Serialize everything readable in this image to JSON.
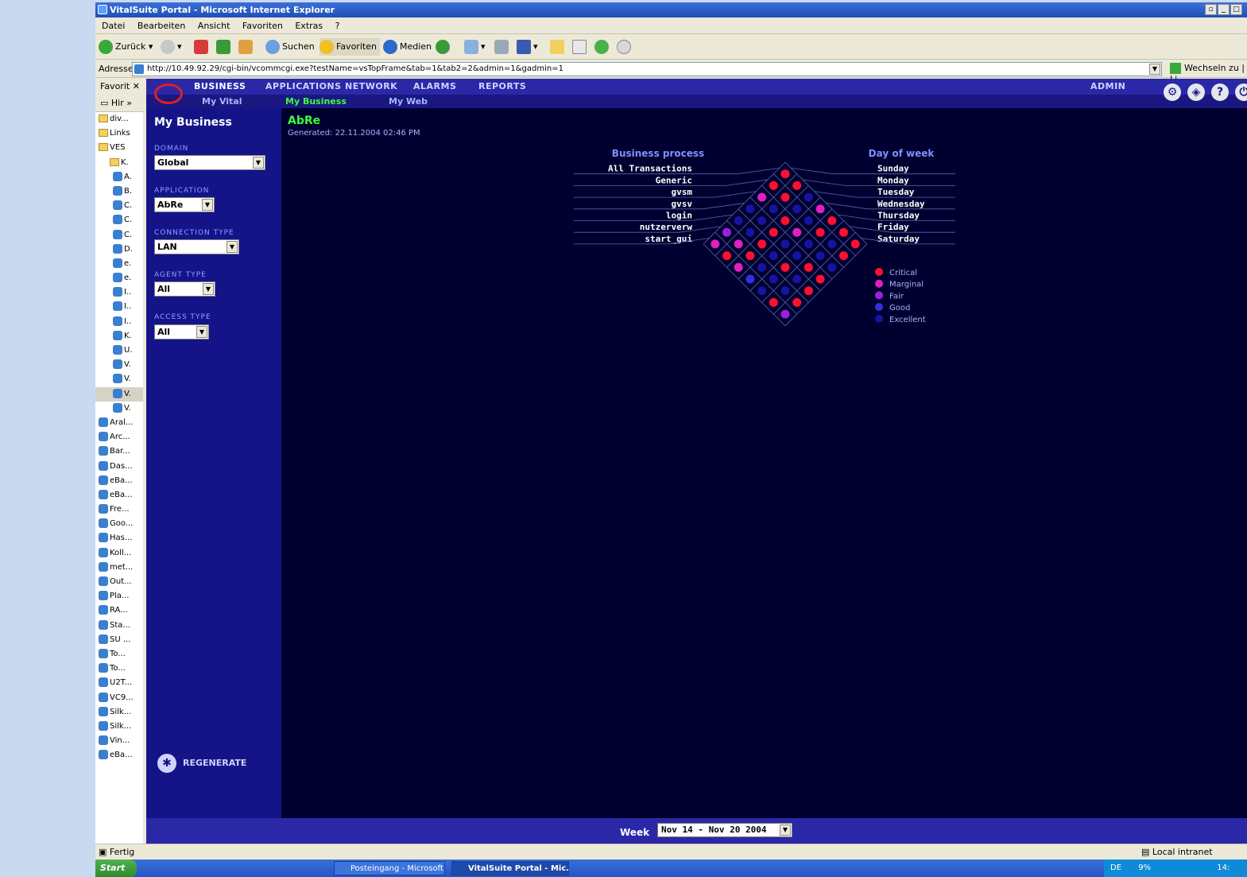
{
  "window": {
    "title": "VitalSuite Portal - Microsoft Internet Explorer"
  },
  "menubar": [
    "Datei",
    "Bearbeiten",
    "Ansicht",
    "Favoriten",
    "Extras",
    "?"
  ],
  "toolbar": {
    "back": "Zurück",
    "search": "Suchen",
    "favorites": "Favoriten",
    "media": "Medien"
  },
  "address": {
    "label": "Adresse",
    "url": "http://10.49.92.29/cgi-bin/vcommcgi.exe?testName=vsTopFrame&tab=1&tab2=2&admin=1&gadmin=1",
    "go": "Wechseln zu",
    "links": "Li"
  },
  "favorites": {
    "title": "Favorit",
    "history": "Hir",
    "items": [
      {
        "label": "div...",
        "type": "folder"
      },
      {
        "label": "Links",
        "type": "folder"
      },
      {
        "label": "VES",
        "type": "folder"
      },
      {
        "label": "K.",
        "type": "folder"
      },
      {
        "label": "A.",
        "type": "link"
      },
      {
        "label": "B.",
        "type": "link"
      },
      {
        "label": "C.",
        "type": "link"
      },
      {
        "label": "C.",
        "type": "link"
      },
      {
        "label": "C.",
        "type": "link"
      },
      {
        "label": "D.",
        "type": "link"
      },
      {
        "label": "e.",
        "type": "link"
      },
      {
        "label": "e.",
        "type": "link"
      },
      {
        "label": "I..",
        "type": "link"
      },
      {
        "label": "I..",
        "type": "link"
      },
      {
        "label": "I..",
        "type": "link"
      },
      {
        "label": "K.",
        "type": "link"
      },
      {
        "label": "U.",
        "type": "link"
      },
      {
        "label": "V.",
        "type": "link"
      },
      {
        "label": "V.",
        "type": "link"
      },
      {
        "label": "V.",
        "type": "link"
      },
      {
        "label": "V.",
        "type": "link"
      },
      {
        "label": "Aral...",
        "type": "link"
      },
      {
        "label": "Arc...",
        "type": "link"
      },
      {
        "label": "Bar...",
        "type": "link"
      },
      {
        "label": "Das...",
        "type": "link"
      },
      {
        "label": "eBa...",
        "type": "link"
      },
      {
        "label": "eBa...",
        "type": "link"
      },
      {
        "label": "Fre...",
        "type": "link"
      },
      {
        "label": "Goo...",
        "type": "link"
      },
      {
        "label": "Has...",
        "type": "link"
      },
      {
        "label": "Koll...",
        "type": "link"
      },
      {
        "label": "met...",
        "type": "link"
      },
      {
        "label": "Out...",
        "type": "link"
      },
      {
        "label": "Pla...",
        "type": "link"
      },
      {
        "label": "RA...",
        "type": "link"
      },
      {
        "label": "Sta...",
        "type": "link"
      },
      {
        "label": "SU ...",
        "type": "link"
      },
      {
        "label": "To...",
        "type": "link"
      },
      {
        "label": "To...",
        "type": "link"
      },
      {
        "label": "U2T...",
        "type": "link"
      },
      {
        "label": "VC9...",
        "type": "link"
      },
      {
        "label": "Silk...",
        "type": "link"
      },
      {
        "label": "Silk...",
        "type": "link"
      },
      {
        "label": "Vin...",
        "type": "link"
      },
      {
        "label": "eBa...",
        "type": "link"
      }
    ]
  },
  "nav": {
    "tabs": [
      "BUSINESS",
      "APPLICATIONS",
      "NETWORK",
      "ALARMS",
      "REPORTS"
    ],
    "admin": "ADMIN",
    "subtabs": [
      "My Vital",
      "My Business",
      "My Web"
    ]
  },
  "sidebar": {
    "heading": "My Business",
    "domain": {
      "label": "DOMAIN",
      "value": "Global"
    },
    "application": {
      "label": "APPLICATION",
      "value": "AbRe"
    },
    "connection": {
      "label": "CONNECTION TYPE",
      "value": "LAN"
    },
    "agent": {
      "label": "AGENT TYPE",
      "value": "All"
    },
    "access": {
      "label": "ACCESS TYPE",
      "value": "All"
    },
    "regenerate": "REGENERATE"
  },
  "main": {
    "title": "AbRe",
    "generated": "Generated: 22.11.2004 02:46 PM"
  },
  "chart_data": {
    "type": "heatmap",
    "row_title": "Business process",
    "col_title": "Day of week",
    "rows": [
      "All Transactions",
      "Generic",
      "gvsm",
      "gvsv",
      "login",
      "nutzerverw",
      "start_gui"
    ],
    "cols": [
      "Sunday",
      "Monday",
      "Tuesday",
      "Wednesday",
      "Thursday",
      "Friday",
      "Saturday"
    ],
    "legend": [
      "Critical",
      "Marginal",
      "Fair",
      "Good",
      "Excellent"
    ],
    "colors": {
      "Critical": "#ff1030",
      "Marginal": "#e020c0",
      "Fair": "#9a20e0",
      "Good": "#3030e0",
      "Excellent": "#1414a0"
    },
    "values": [
      [
        "Critical",
        "Critical",
        "Excellent",
        "Marginal",
        "Critical",
        "Critical",
        "Critical"
      ],
      [
        "Critical",
        "Critical",
        "Excellent",
        "Excellent",
        "Critical",
        "Excellent",
        "Critical"
      ],
      [
        "Marginal",
        "Excellent",
        "Critical",
        "Marginal",
        "Excellent",
        "Excellent",
        "Excellent"
      ],
      [
        "Excellent",
        "Excellent",
        "Critical",
        "Excellent",
        "Excellent",
        "Critical",
        "Critical"
      ],
      [
        "Excellent",
        "Excellent",
        "Critical",
        "Excellent",
        "Critical",
        "Excellent",
        "Critical"
      ],
      [
        "Fair",
        "Marginal",
        "Critical",
        "Excellent",
        "Excellent",
        "Excellent",
        "Critical"
      ],
      [
        "Marginal",
        "Critical",
        "Marginal",
        "Good",
        "Excellent",
        "Critical",
        "Fair"
      ]
    ]
  },
  "footer": {
    "week_label": "Week",
    "week_value": "Nov 14 - Nov 20 2004"
  },
  "status": {
    "left": "Fertig",
    "zone": "Local intranet"
  },
  "taskbar": {
    "start": "Start",
    "tasks": [
      "Posteingang - Microsoft ...",
      "VitalSuite Portal - Mic..."
    ],
    "lang": "DE",
    "cpu": "9%",
    "clock": "14:"
  }
}
